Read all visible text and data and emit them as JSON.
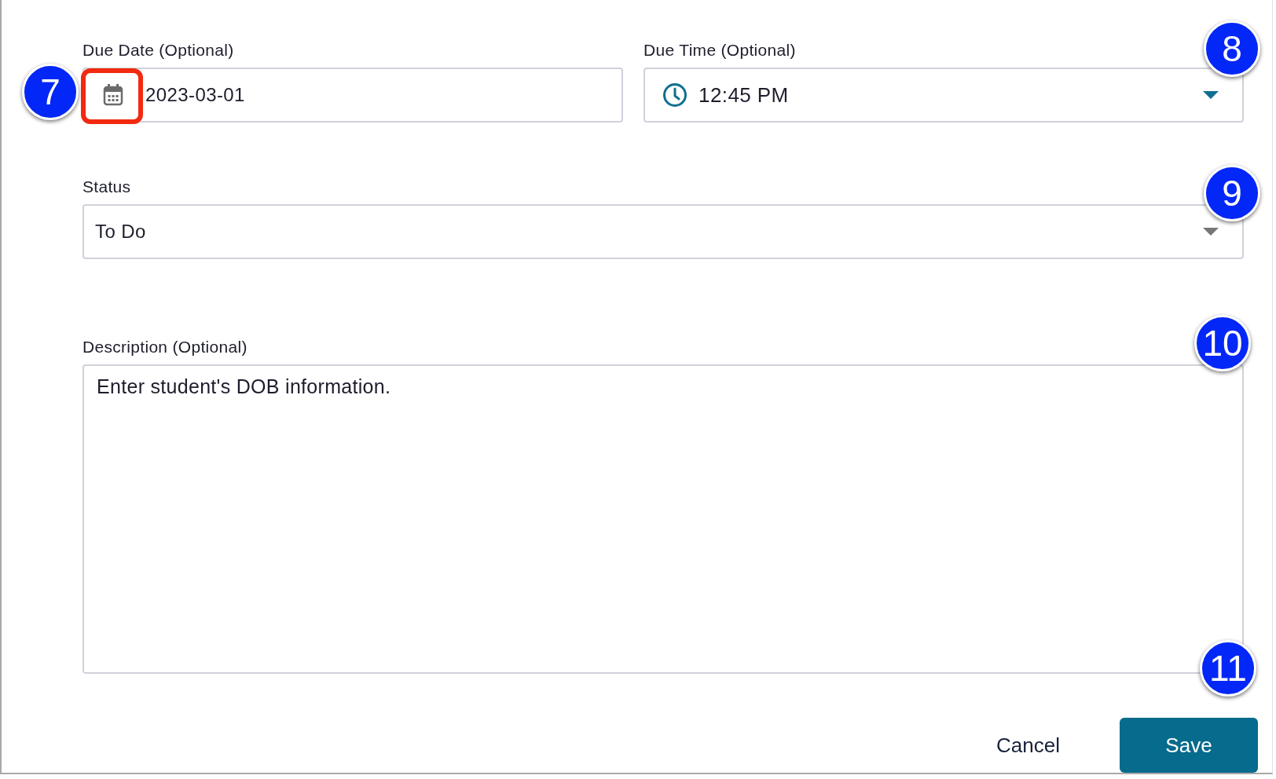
{
  "due_date": {
    "label": "Due Date (Optional)",
    "value": "2023-03-01",
    "highlighted": true
  },
  "due_time": {
    "label": "Due Time (Optional)",
    "value": "12:45 PM"
  },
  "status": {
    "label": "Status",
    "value": "To Do"
  },
  "description": {
    "label": "Description (Optional)",
    "value": "Enter student's DOB information."
  },
  "buttons": [
    {
      "label": "Cancel",
      "kind": "text"
    },
    {
      "label": "Save",
      "kind": "primary"
    }
  ],
  "callouts": [
    {
      "number": "7"
    },
    {
      "number": "8"
    },
    {
      "number": "9"
    },
    {
      "number": "10"
    },
    {
      "number": "11"
    }
  ]
}
